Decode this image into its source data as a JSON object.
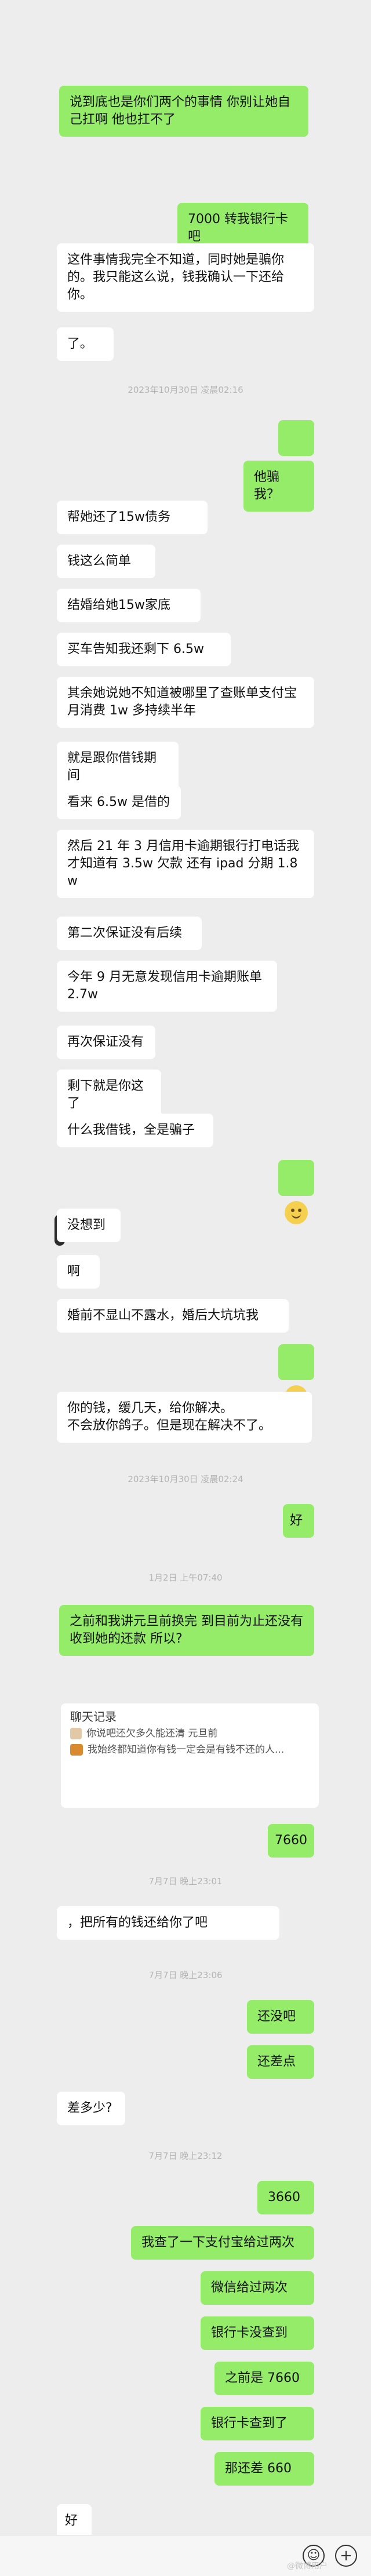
{
  "messages": {
    "m1": "说到底也是你们两个的事情 你别让她自己扛啊 他也扛不了",
    "m2": "7000 转我银行卡吧",
    "m3": "这件事情我完全不知道，同时她是骗你的。我只能这么说，钱我确认一下还给你。",
    "m4": "了。",
    "m5": "他骗我？",
    "m6": "帮她还了15w债务",
    "m7": "钱这么简单",
    "m8": "结婚给她15w家底",
    "m9": "买车告知我还剩下 6.5w",
    "m10": "其余她说她不知道被哪里了查账单支付宝月消费 1w 多持续半年",
    "m11": "就是跟你借钱期间",
    "m12": "看来 6.5w 是借的",
    "m13": "然后 21 年 3 月信用卡逾期银行打电话我才知道有 3.5w 欠款 还有 ipad 分期 1.8w",
    "m14": "第二次保证没有后续",
    "m15": "今年 9 月无意发现信用卡逾期账单 2.7w",
    "m16": "再次保证没有",
    "m17": "剩下就是你这了",
    "m18": "什么我借钱，全是骗子",
    "m19": "没想到",
    "m20": "啊",
    "m21": "婚前不显山不露水，婚后大坑坑我",
    "m22": "你的钱，缓几天，给你解决。\n不会放你鸽子。但是现在解决不了。",
    "m23": "好",
    "m24": "之前和我讲元旦前换完 到目前为止还没有收到她的还款 所以?",
    "m25": "7660",
    "m26": "，把所有的钱还给你了吧",
    "m27": "还没吧",
    "m28": "还差点",
    "m29": "差多少?",
    "m30": "3660",
    "m31": "我查了一下支付宝给过两次",
    "m32": "微信给过两次",
    "m33": "银行卡没查到",
    "m34": "之前是 7660",
    "m35": "银行卡查到了",
    "m36": "那还差 660",
    "m37": "好"
  },
  "timestamps": {
    "t1": "2023年10月30日 凌晨02:16",
    "t2": "2023年10月30日 凌晨02:24",
    "t3": "1月2日 上午07:40",
    "t4": "7月7日 晚上23:01",
    "t5": "7月7日 晚上23:06",
    "t6": "7月7日 晚上23:12"
  },
  "recap": {
    "title": "聊天记录",
    "line1": "你说吧还欠多久能还清 元旦前",
    "line2": "我始终都知道你有钱一定会是有钱不还的人..."
  },
  "footer": {
    "watermark": "@微博用户",
    "emoji_icon": "smiley-face-icon",
    "plus_icon": "plus-icon"
  },
  "colors": {
    "background": "#ededed",
    "received_bubble": "#ffffff",
    "sent_bubble": "#95ec69",
    "timestamp_text": "#b4b4b4"
  }
}
